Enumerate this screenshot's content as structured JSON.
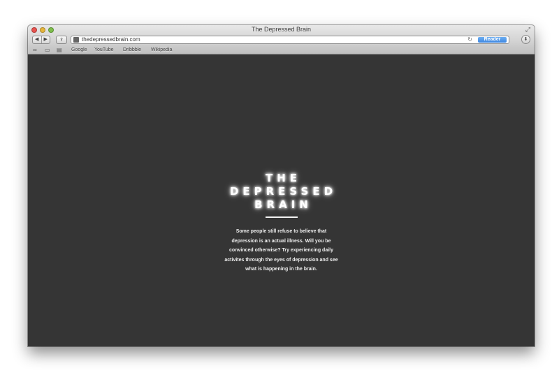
{
  "window": {
    "title": "The Depressed Brain"
  },
  "toolbar": {
    "back_icon": "◀",
    "forward_icon": "▶",
    "share_icon": "⇪",
    "url": "thedepressedbrain.com",
    "reload_icon": "↻",
    "reader_label": "Reader",
    "download_icon": "⬇"
  },
  "bookmarks": {
    "items": [
      {
        "label": "Google"
      },
      {
        "label": "YouTube"
      },
      {
        "label": "Dribbble"
      },
      {
        "label": "Wikipedia"
      }
    ]
  },
  "page": {
    "logo_lines": [
      "THE",
      "DEPRESSED",
      "BRAIN"
    ],
    "description": "Some people still refuse to believe that depression is an actual illness. Will you be convinced otherwise? Try experiencing daily activites through the eyes of depression and see what is happening in the brain."
  },
  "colors": {
    "page_background": "#353535",
    "reader_button": "#3d86e0",
    "close_light": "#e9534f",
    "minimize_light": "#e6b63b",
    "zoom_light": "#7ebf4c"
  }
}
